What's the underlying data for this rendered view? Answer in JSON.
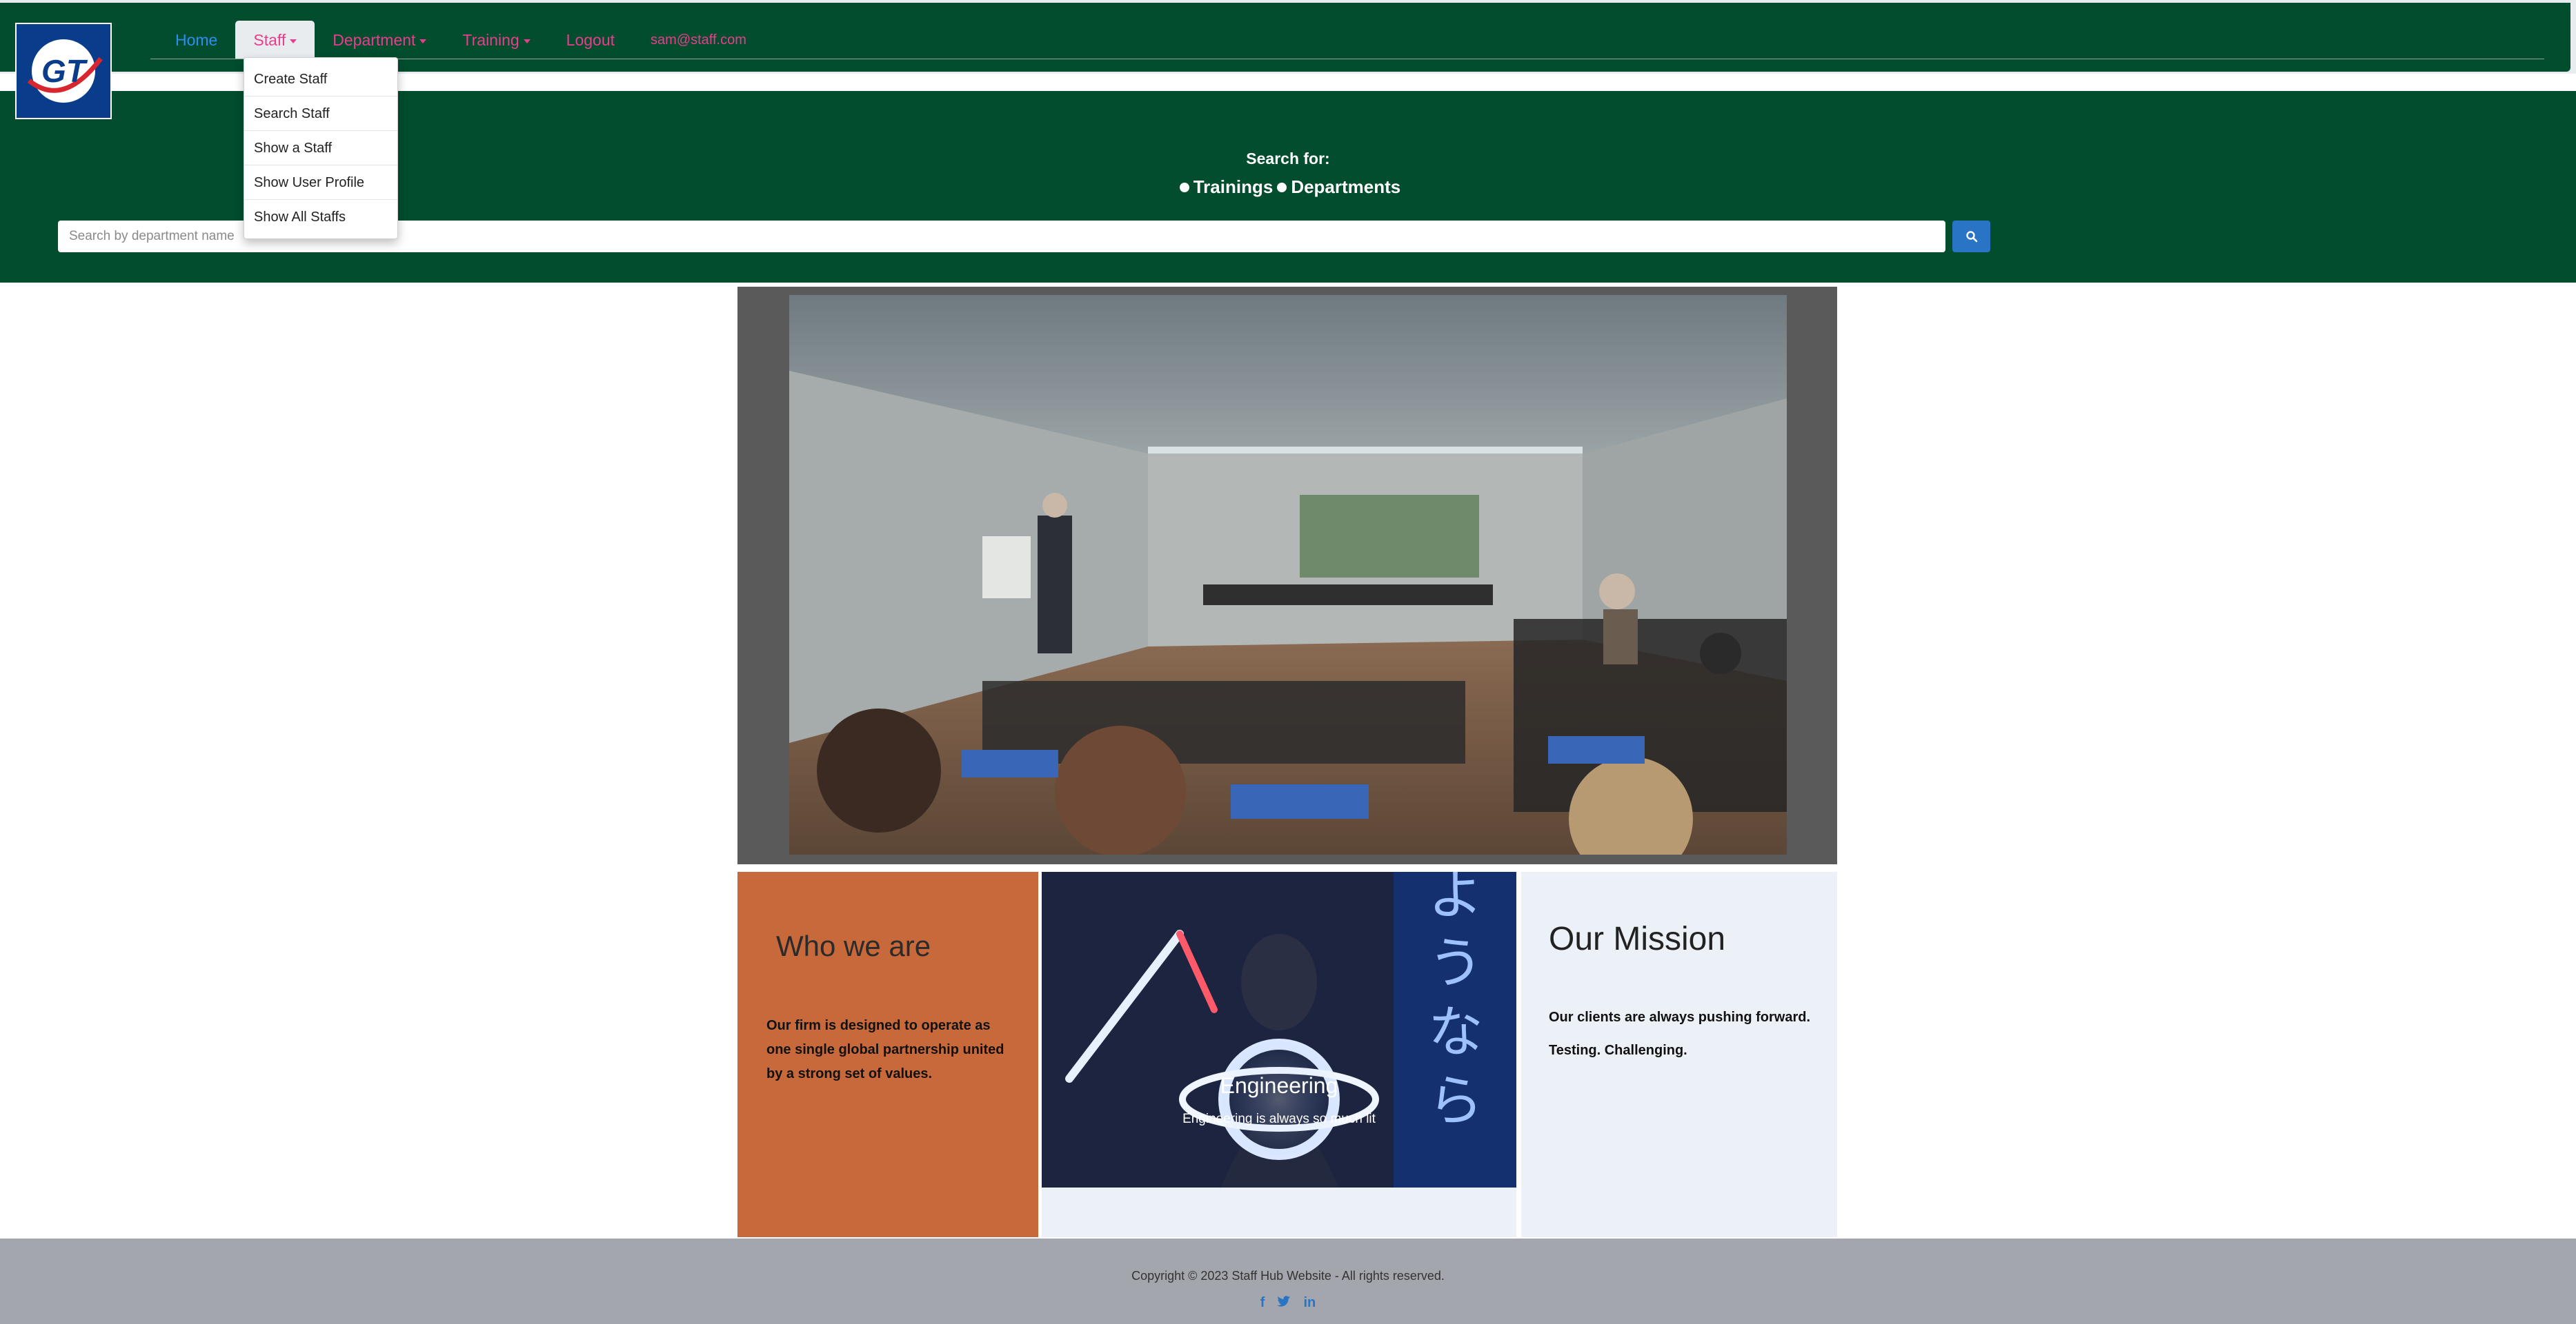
{
  "logo": {
    "text": "GT"
  },
  "nav": {
    "home": "Home",
    "staff": "Staff",
    "department": "Department",
    "training": "Training",
    "logout": "Logout",
    "email": "sam@staff.com"
  },
  "staff_menu": {
    "items": [
      {
        "label": "Create Staff"
      },
      {
        "label": "Search Staff"
      },
      {
        "label": "Show a Staff"
      },
      {
        "label": "Show User Profile"
      },
      {
        "label": "Show All Staffs"
      }
    ]
  },
  "search": {
    "label": "Search for:",
    "options": [
      "Trainings",
      "Departments"
    ],
    "placeholder": "Search by department name",
    "button_icon": "search-icon"
  },
  "cards": {
    "who": {
      "title": "Who we are",
      "text": "Our firm is designed to operate as one single global partnership united by a strong set of values."
    },
    "engineering": {
      "title": "Engineering",
      "subtitle": "Engineering is always so much lit"
    },
    "mission": {
      "title": "Our Mission",
      "line1": "Our clients are always pushing forward.",
      "line2": "Testing. Challenging."
    }
  },
  "footer": {
    "copyright": "Copyright © 2023 Staff Hub Website - All rights reserved.",
    "socials": [
      "f",
      "t",
      "in"
    ]
  },
  "colors": {
    "nav_bg": "#014d2e",
    "nav_link": "#e83e8c",
    "home_link": "#2b8ef0",
    "who_card": "#c8693b",
    "mission_card": "#ecf1f8",
    "footer": "#a3a7ad",
    "accent": "#2a74c6"
  }
}
